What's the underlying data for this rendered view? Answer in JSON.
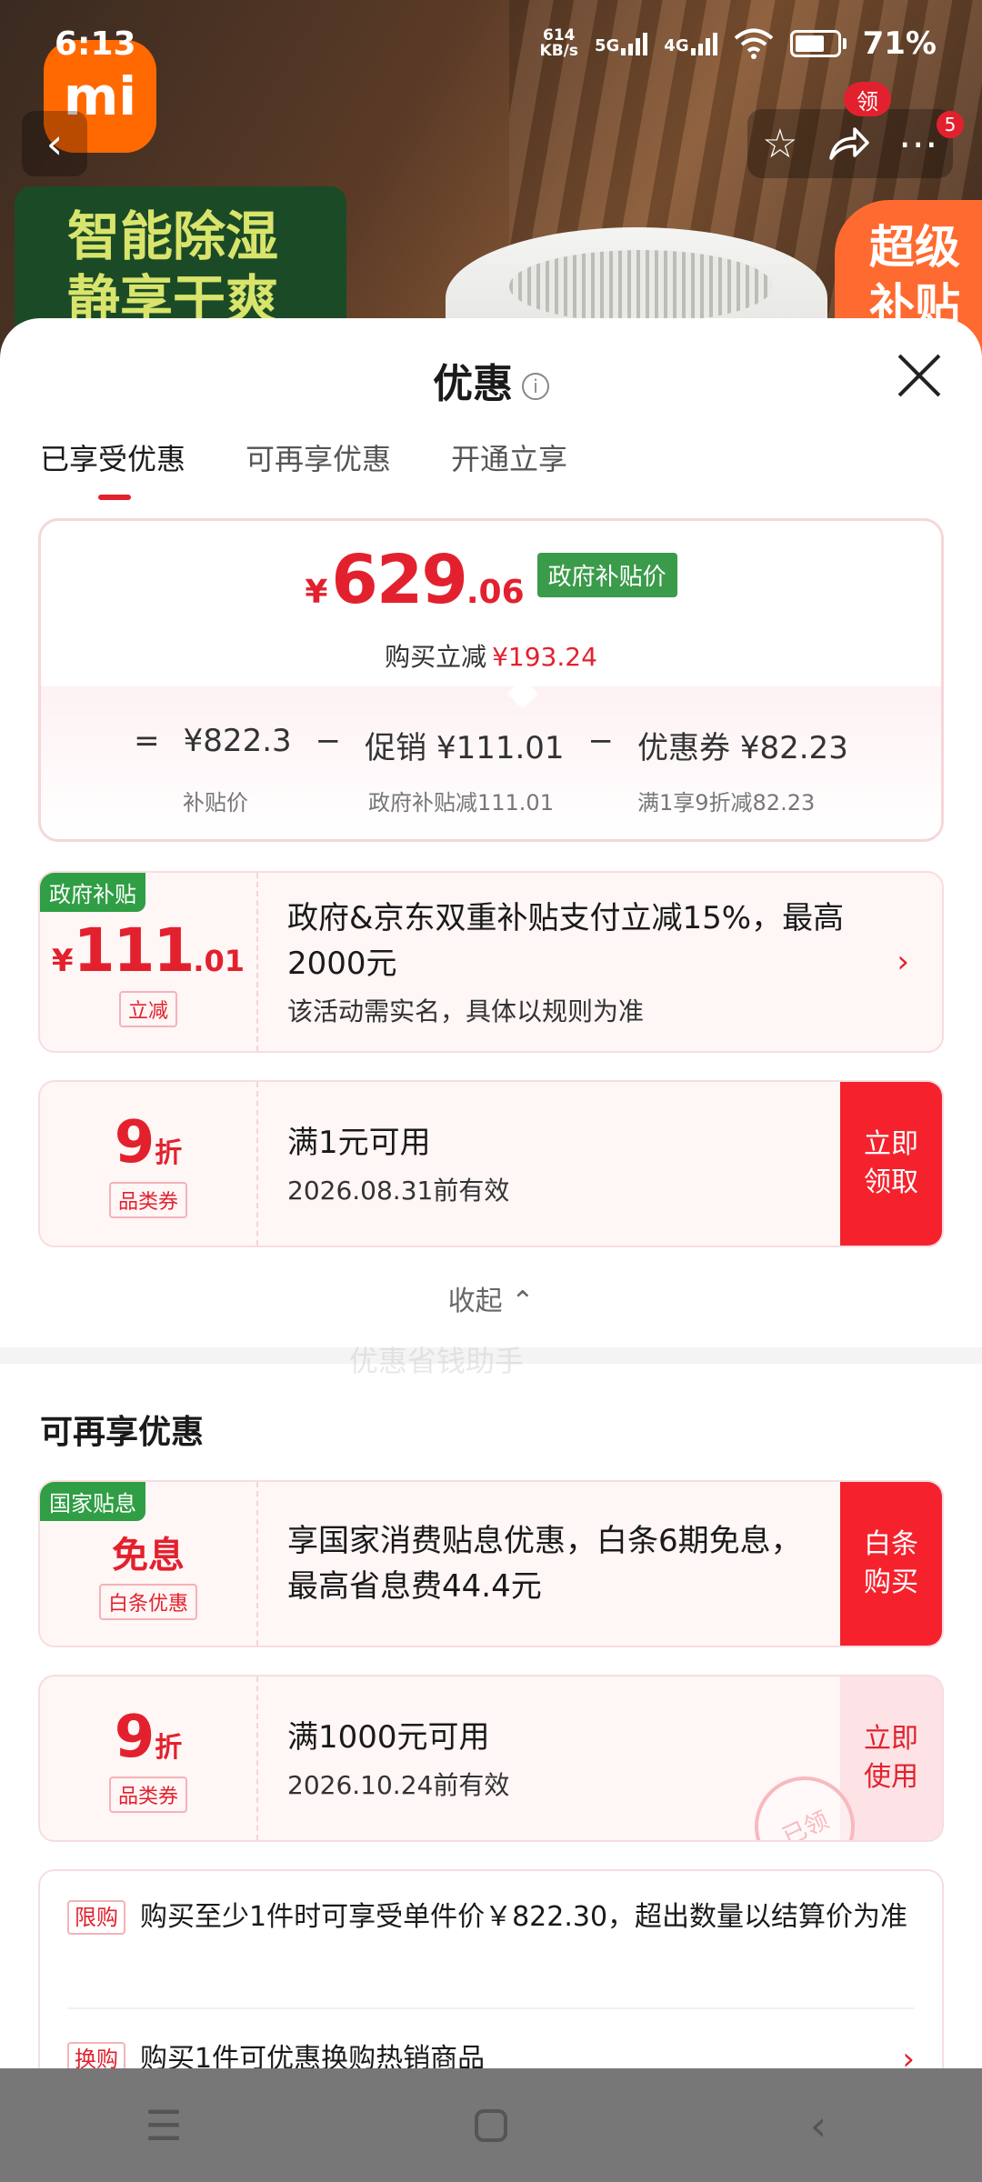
{
  "status_bar": {
    "time": "6:13",
    "net_speed_top": "614",
    "net_speed_bottom": "KB/s",
    "sig1": "5G",
    "sig2": "4G",
    "battery": "71%",
    "battery_level": 0.71
  },
  "hero": {
    "logo_text": "mi",
    "green_tag_line1": "智能除湿",
    "green_tag_line2": "静享干爽",
    "orange_tag_line1": "超级",
    "orange_tag_line2": "补贴",
    "ling_badge": "领",
    "cart_count": "5"
  },
  "sheet": {
    "title": "优惠",
    "info_icon": "i",
    "tabs": [
      "已享受优惠",
      "可再享优惠",
      "开通立享"
    ],
    "active_tab": 0
  },
  "summary": {
    "yen": "¥",
    "price_int": "629",
    "price_dec": ".06",
    "price_tag": "政府补贴价",
    "save_label": "购买立减",
    "save_amount": "¥193.24",
    "formula": [
      "=",
      "¥822.3",
      "−",
      "促销 ¥111.01",
      "−",
      "优惠券 ¥82.23"
    ],
    "labels": [
      "补贴价",
      "政府补贴减111.01",
      "满1享9折减82.23"
    ]
  },
  "card_gov": {
    "corner": "政府补贴",
    "yen": "¥",
    "amount_int": "111",
    "amount_dec": ".01",
    "tag": "立减",
    "main": "政府&京东双重补贴支付立减15%，最高2000元",
    "sub": "该活动需实名，具体以规则为准",
    "chevron": "›"
  },
  "watermark": "优惠省钱助手",
  "card_coupon1": {
    "discount": "9",
    "unit": "折",
    "tag": "品类券",
    "main": "满1元可用",
    "sub": "2026.08.31前有效",
    "action_line1": "立即",
    "action_line2": "领取"
  },
  "collapse": "收起 ⌃",
  "section2_title": "可再享优惠",
  "card_interest": {
    "corner": "国家贴息",
    "title": "免息",
    "tag": "白条优惠",
    "main": "享国家消费贴息优惠，白条6期免息，最高省息费44.4元",
    "action_line1": "白条",
    "action_line2": "购买"
  },
  "card_coupon2": {
    "discount": "9",
    "unit": "折",
    "tag": "品类券",
    "main": "满1000元可用",
    "sub": "2026.10.24前有效",
    "action_line1": "立即",
    "action_line2": "使用",
    "stamp": "已领"
  },
  "notes": [
    {
      "tag": "限购",
      "text": "购买至少1件时可享受单件价￥822.30，超出数量以结算价为准"
    },
    {
      "tag": "换购",
      "text": "购买1件可优惠换购热销商品",
      "chevron": "›"
    }
  ],
  "colors": {
    "accent": "#e3212e",
    "gov_green": "#3a9b4a",
    "action_red": "#f5222d"
  }
}
